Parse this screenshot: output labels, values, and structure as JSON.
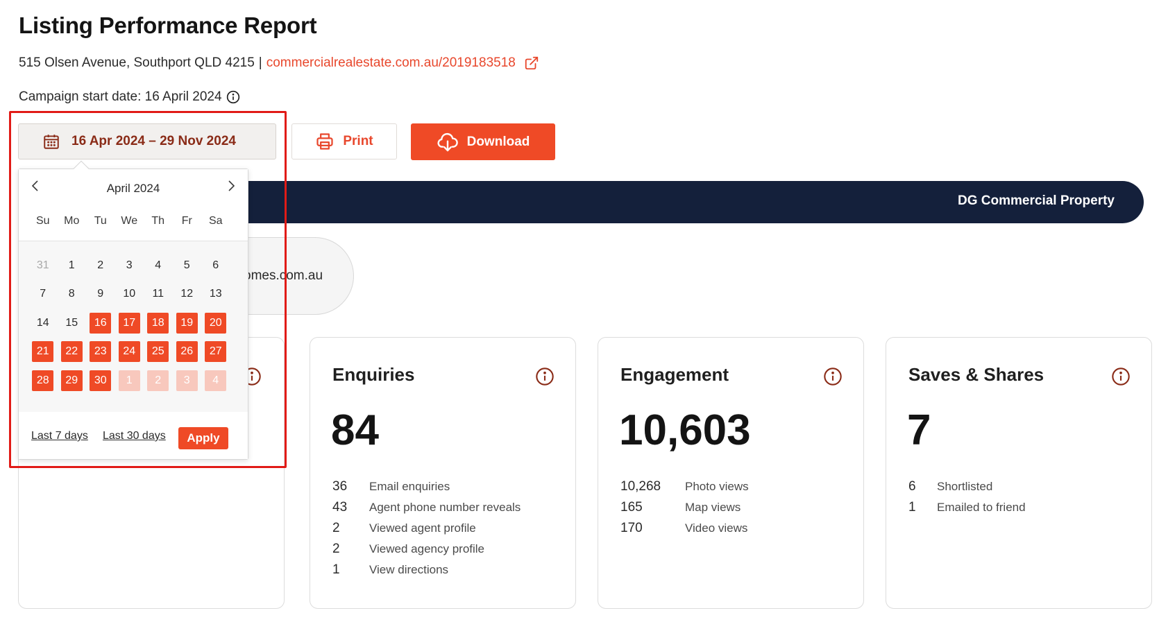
{
  "header": {
    "title": "Listing Performance Report",
    "address": "515 Olsen Avenue, Southport QLD 4215",
    "separator": "|",
    "listing_url": "commercialrealestate.com.au/2019183518",
    "campaign_start": "Campaign start date: 16 April 2024"
  },
  "toolbar": {
    "date_range": "16 Apr 2024 – 29 Nov 2024",
    "print_label": "Print",
    "download_label": "Download"
  },
  "agency": {
    "name": "DG Commercial Property"
  },
  "site_pill": {
    "text": "omes.com.au"
  },
  "calendar": {
    "month": "April 2024",
    "weekdays": [
      "Su",
      "Mo",
      "Tu",
      "We",
      "Th",
      "Fr",
      "Sa"
    ],
    "days": [
      {
        "d": "31",
        "s": "muted"
      },
      {
        "d": "1",
        "s": ""
      },
      {
        "d": "2",
        "s": ""
      },
      {
        "d": "3",
        "s": ""
      },
      {
        "d": "4",
        "s": ""
      },
      {
        "d": "5",
        "s": ""
      },
      {
        "d": "6",
        "s": ""
      },
      {
        "d": "7",
        "s": ""
      },
      {
        "d": "8",
        "s": ""
      },
      {
        "d": "9",
        "s": ""
      },
      {
        "d": "10",
        "s": ""
      },
      {
        "d": "11",
        "s": ""
      },
      {
        "d": "12",
        "s": ""
      },
      {
        "d": "13",
        "s": ""
      },
      {
        "d": "14",
        "s": ""
      },
      {
        "d": "15",
        "s": ""
      },
      {
        "d": "16",
        "s": "sel"
      },
      {
        "d": "17",
        "s": "sel"
      },
      {
        "d": "18",
        "s": "sel"
      },
      {
        "d": "19",
        "s": "sel"
      },
      {
        "d": "20",
        "s": "sel"
      },
      {
        "d": "21",
        "s": "sel"
      },
      {
        "d": "22",
        "s": "sel"
      },
      {
        "d": "23",
        "s": "sel"
      },
      {
        "d": "24",
        "s": "sel"
      },
      {
        "d": "25",
        "s": "sel"
      },
      {
        "d": "26",
        "s": "sel"
      },
      {
        "d": "27",
        "s": "sel"
      },
      {
        "d": "28",
        "s": "sel"
      },
      {
        "d": "29",
        "s": "sel"
      },
      {
        "d": "30",
        "s": "sel"
      },
      {
        "d": "1",
        "s": "sel-faded"
      },
      {
        "d": "2",
        "s": "sel-faded"
      },
      {
        "d": "3",
        "s": "sel-faded"
      },
      {
        "d": "4",
        "s": "sel-faded"
      }
    ],
    "last7_label": "Last 7 days",
    "last30_label": "Last 30 days",
    "apply_label": "Apply"
  },
  "cards": {
    "enquiries": {
      "title": "Enquiries",
      "value": "84",
      "rows": [
        {
          "count": "36",
          "label": "Email enquiries"
        },
        {
          "count": "43",
          "label": "Agent phone number reveals"
        },
        {
          "count": "2",
          "label": "Viewed agent profile"
        },
        {
          "count": "2",
          "label": "Viewed agency profile"
        },
        {
          "count": "1",
          "label": "View directions"
        }
      ]
    },
    "engagement": {
      "title": "Engagement",
      "value": "10,603",
      "rows": [
        {
          "count": "10,268",
          "label": "Photo views"
        },
        {
          "count": "165",
          "label": "Map views"
        },
        {
          "count": "170",
          "label": "Video views"
        }
      ]
    },
    "saves": {
      "title": "Saves & Shares",
      "value": "7",
      "rows": [
        {
          "count": "6",
          "label": "Shortlisted"
        },
        {
          "count": "1",
          "label": "Emailed to friend"
        }
      ]
    }
  },
  "colors": {
    "accent": "#ef4a26",
    "navy": "#14203b",
    "highlight": "#e11b17"
  }
}
